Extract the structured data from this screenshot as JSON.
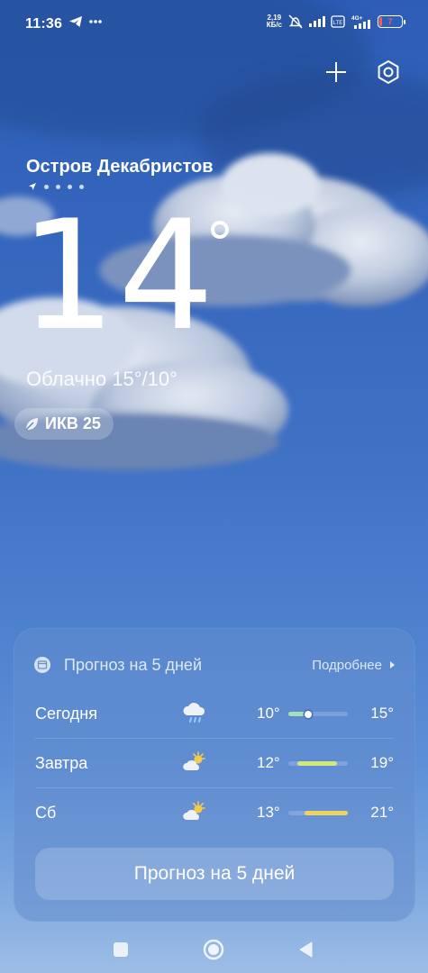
{
  "status_bar": {
    "time": "11:36",
    "left_icons": [
      "telegram-icon",
      "more-icon"
    ],
    "speed_value": "2,19",
    "speed_unit": "КБ/с",
    "network": "4G+",
    "battery": "7"
  },
  "header": {
    "location": "Остров Декабристов",
    "current_temp": "14",
    "degree_symbol": "°",
    "condition": "Облачно  15°/10°",
    "aqi": "ИКВ 25"
  },
  "forecast": {
    "title": "Прогноз на 5 дней",
    "more": "Подробнее",
    "days": [
      {
        "day": "Сегодня",
        "icon": "rain-cloud-icon",
        "min": "10°",
        "max": "15°",
        "bar_start": 0.0,
        "bar_end": 0.35,
        "current_marker": 0.33,
        "bar_color": "#a6e0b5"
      },
      {
        "day": "Завтра",
        "icon": "partly-cloudy-icon",
        "min": "12°",
        "max": "19°",
        "bar_start": 0.15,
        "bar_end": 0.82,
        "bar_color": "#d4e87a"
      },
      {
        "day": "Сб",
        "icon": "partly-cloudy-icon",
        "min": "13°",
        "max": "21°",
        "bar_start": 0.28,
        "bar_end": 1.0,
        "bar_color": "#f0d35c"
      }
    ],
    "button": "Прогноз на 5 дней"
  },
  "colors": {
    "battery_low": "#ff5a4e",
    "sun": "#f7c948"
  }
}
